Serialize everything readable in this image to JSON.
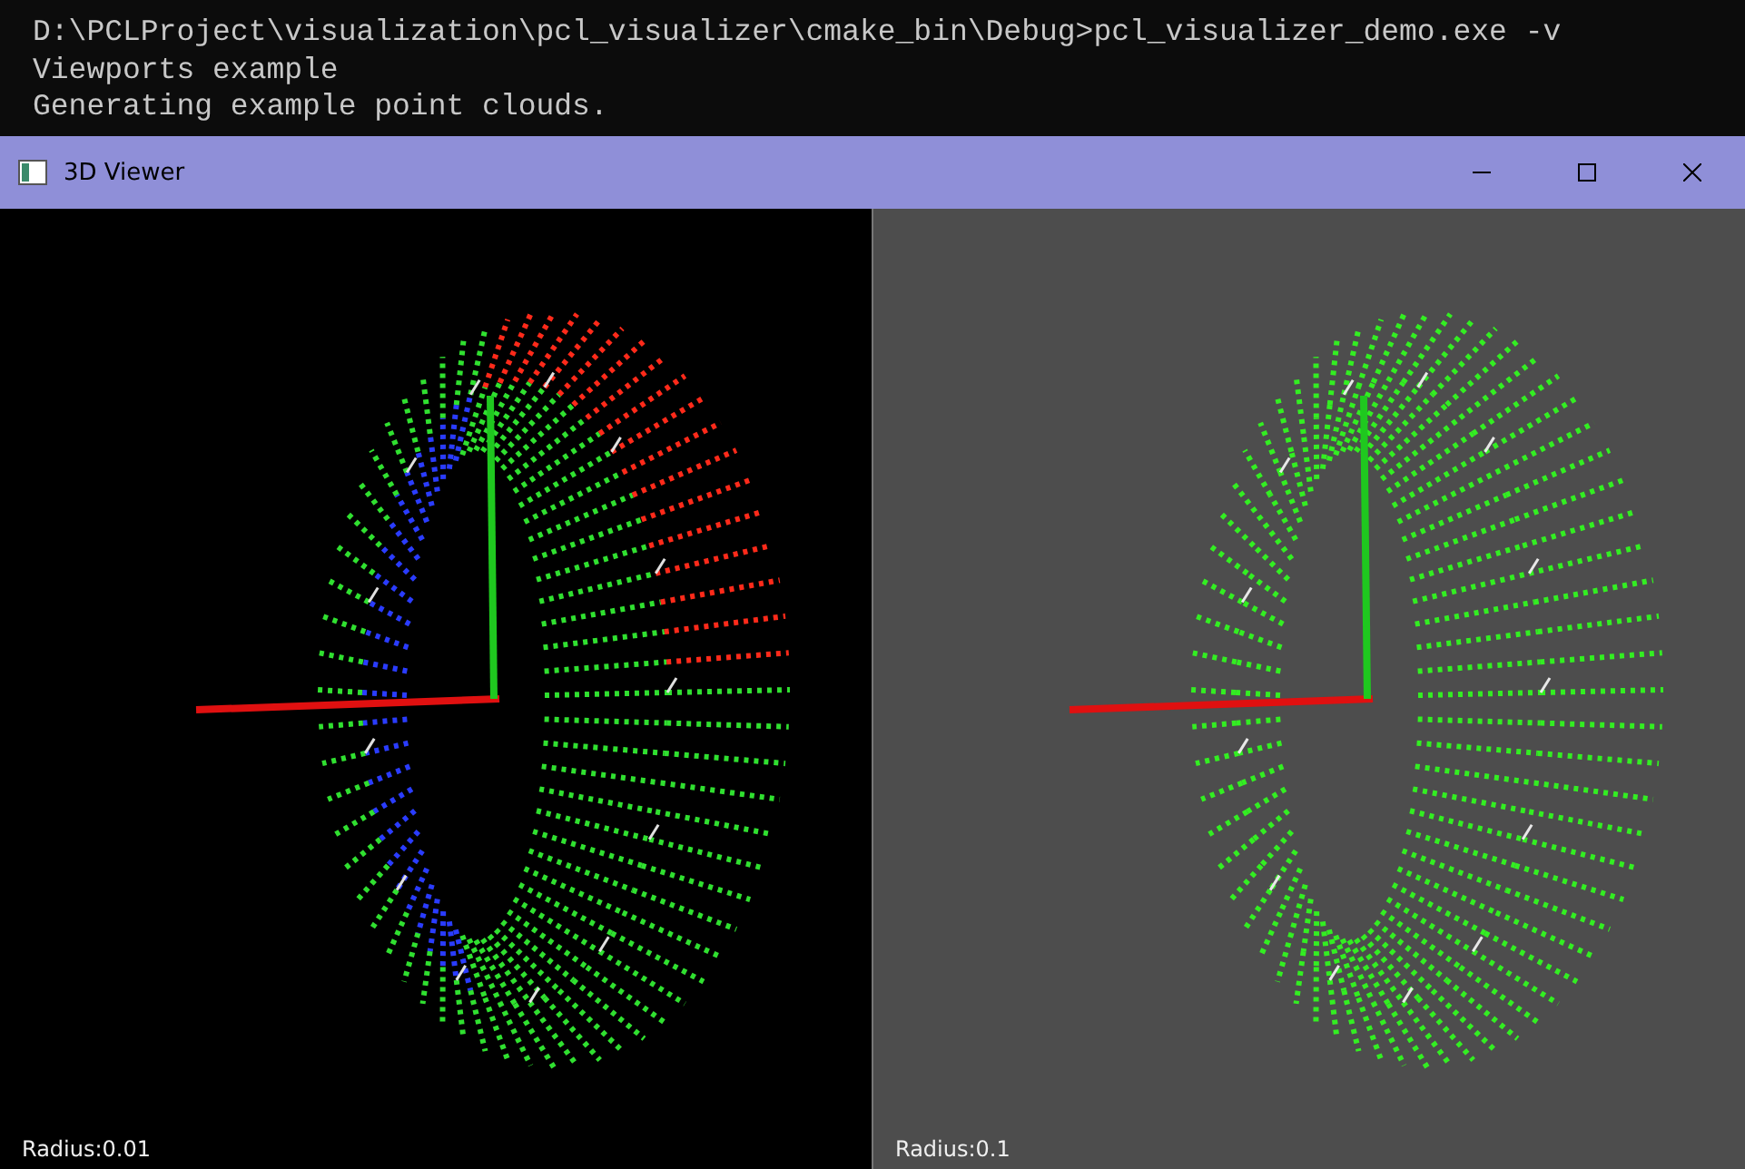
{
  "console": {
    "lines": [
      "D:\\PCLProject\\visualization\\pcl_visualizer\\cmake_bin\\Debug>pcl_visualizer_demo.exe -v",
      "Viewports example",
      "Generating example point clouds."
    ]
  },
  "window": {
    "title": "3D Viewer"
  },
  "viewports": [
    {
      "kind": "gradient",
      "label": "Radius:0.01"
    },
    {
      "kind": "single",
      "label": "Radius:0.1"
    }
  ]
}
